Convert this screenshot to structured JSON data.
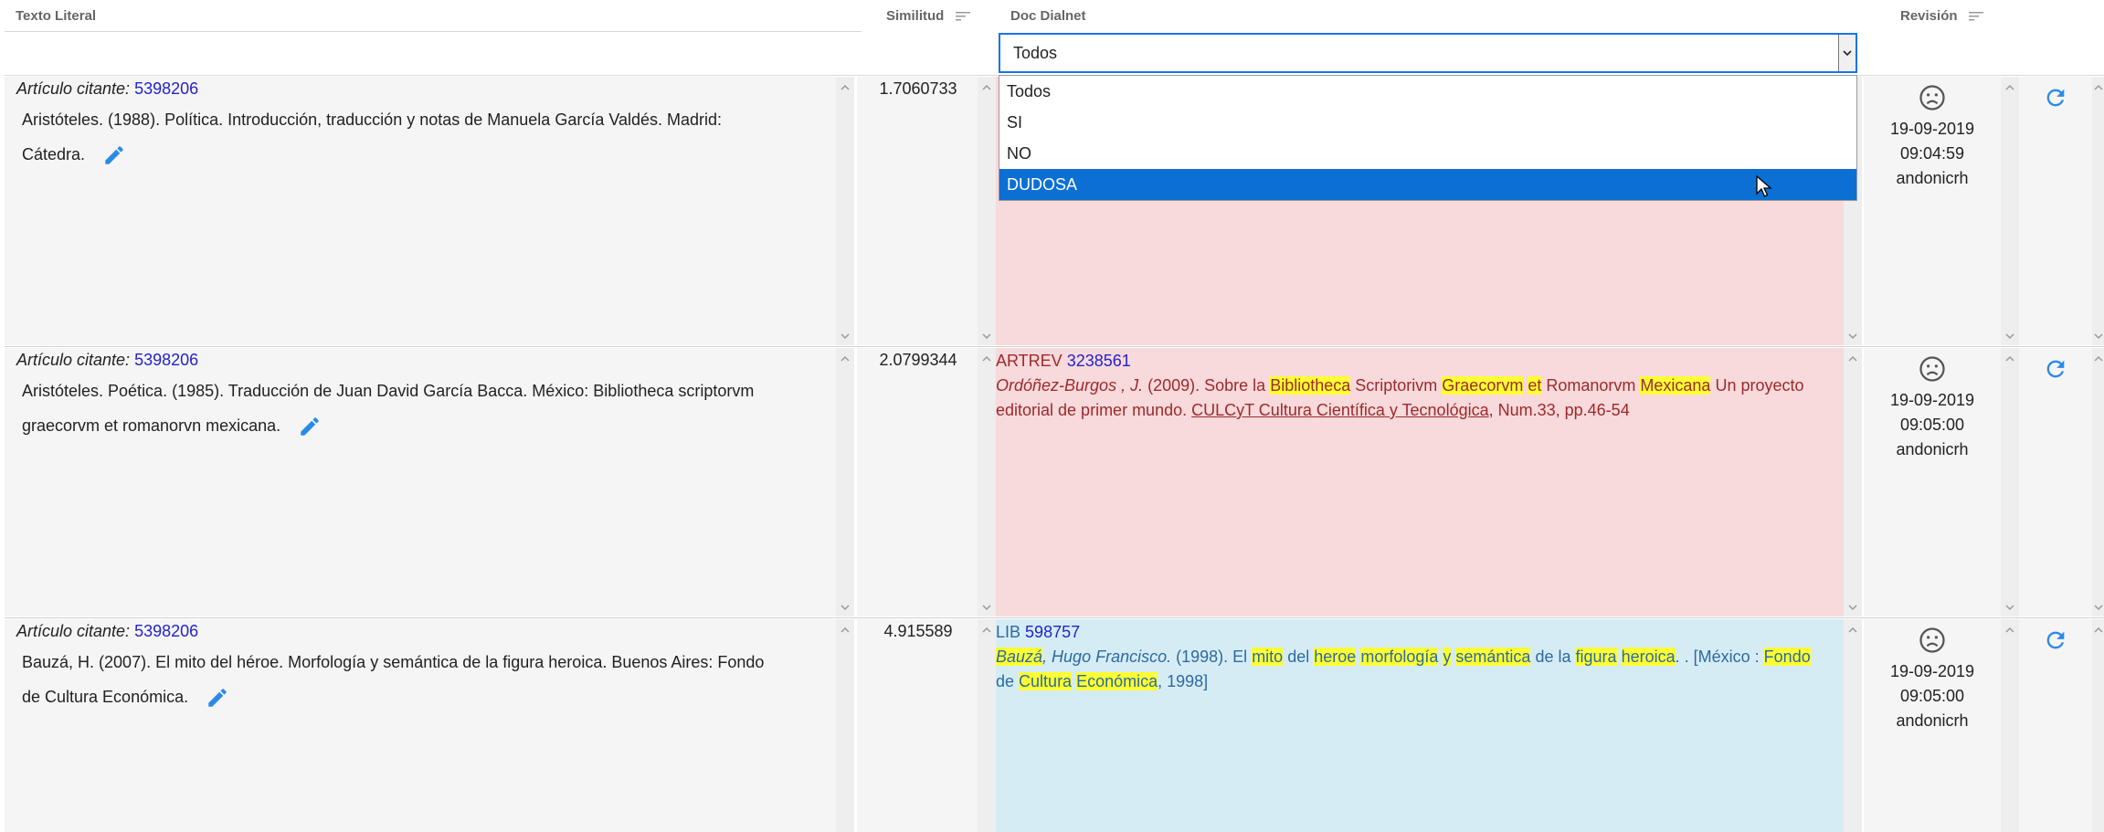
{
  "header": {
    "texto_literal": "Texto Literal",
    "similitud": "Similitud",
    "doc_dialnet": "Doc Dialnet",
    "revision": "Revisión"
  },
  "filter": {
    "selected": "Todos",
    "options": [
      "Todos",
      "SI",
      "NO",
      "DUDOSA"
    ],
    "highlighted": "DUDOSA"
  },
  "rows": [
    {
      "label": "Artículo citante:",
      "article_id": "5398206",
      "text_line1": "Aristóteles. (1988). Política. Introducción, traducción y notas de Manuela García Valdés. Madrid:",
      "text_line2": "Cátedra.",
      "similitud": "1.7060733",
      "doc_type": "",
      "doc_id": "",
      "date": "19-09-2019",
      "time": "09:04:59",
      "user": "andonicrh"
    },
    {
      "label": "Artículo citante:",
      "article_id": "5398206",
      "text_line1": "Aristóteles. Poética. (1985). Traducción de Juan David García Bacca. México: Bibliotheca scriptorvm",
      "text_line2": "graecorvm et romanorvn mexicana.",
      "similitud": "2.0799344",
      "doc_type": "ARTREV",
      "doc_id": "3238561",
      "doc_authors": "Ordóñez-Burgos , J.",
      "doc_year": "(2009). Sobre la",
      "hl1": "Bibliotheca",
      "mid1": "Scriptorivm",
      "hl2": "Graecorvm",
      "hl3": "et",
      "mid2": "Romanorvm",
      "hl4": "Mexicana",
      "tail1": "Un proyecto",
      "line2_a": "editorial de primer mundo.",
      "journal": "CULCyT Cultura Científica y Tecnológica",
      "line2_b": ", Num.33, pp.46-54",
      "date": "19-09-2019",
      "time": "09:05:00",
      "user": "andonicrh"
    },
    {
      "label": "Artículo citante:",
      "article_id": "5398206",
      "text_line1": "Bauzá, H. (2007). El mito del héroe. Morfología y semántica de la figura heroica. Buenos Aires: Fondo",
      "text_line2": "de Cultura Económica.",
      "similitud": "4.915589",
      "doc_type": "LIB",
      "doc_id": "598757",
      "author_hl": "Bauzá",
      "author_rest": ", Hugo Francisco.",
      "year": "(1998). El",
      "w_mito": "mito",
      "w_del": "del",
      "w_heroe": "heroe",
      "w_morf": "morfología",
      "w_y": "y",
      "w_sem": "semántica",
      "w_dela": "de la",
      "w_fig": "figura",
      "w_her": "heroica",
      "w_after": ". . [México :",
      "w_fondo": "Fondo",
      "w_de": "de",
      "w_cult": "Cultura",
      "w_econ": "Económica",
      "w_end": ", 1998]",
      "date": "19-09-2019",
      "time": "09:05:00",
      "user": "andonicrh"
    }
  ],
  "colors": {
    "pink_bg": "#f8d9dc",
    "blue_bg": "#d6ecf5",
    "highlight": "#ffff33",
    "selected_option": "#0b6fd3",
    "icon_blue": "#2b8ae6"
  }
}
